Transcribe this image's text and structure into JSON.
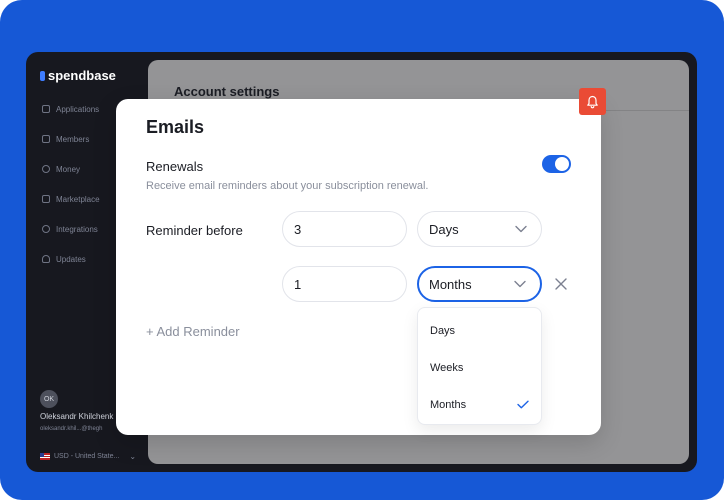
{
  "app": {
    "logo_text": "spendbase"
  },
  "sidebar": {
    "items": [
      {
        "label": "Applications",
        "icon": "grid-icon"
      },
      {
        "label": "Members",
        "icon": "users-icon"
      },
      {
        "label": "Money",
        "icon": "dollar-icon"
      },
      {
        "label": "Marketplace",
        "icon": "bag-icon"
      },
      {
        "label": "Integrations",
        "icon": "link-icon"
      },
      {
        "label": "Updates",
        "icon": "bell-icon"
      }
    ],
    "user": {
      "initials": "OK",
      "name": "Oleksandr Khilchenk",
      "email": "oleksandr.khil...@thegh"
    },
    "currency": "USD - United State..."
  },
  "main": {
    "title": "Account settings"
  },
  "modal": {
    "title": "Emails",
    "renewals_label": "Renewals",
    "renewals_description": "Receive email reminders about your subscription renewal.",
    "renewals_enabled": true,
    "reminder_label": "Reminder before",
    "reminders": [
      {
        "amount": "3",
        "unit": "Days"
      },
      {
        "amount": "1",
        "unit": "Months"
      }
    ],
    "add_reminder": "+ Add Reminder"
  },
  "dropdown": {
    "options": [
      "Days",
      "Weeks",
      "Months"
    ],
    "selected": "Months"
  },
  "colors": {
    "accent": "#1c63e6",
    "bell": "#ea4b35",
    "background": "#1658d6"
  }
}
